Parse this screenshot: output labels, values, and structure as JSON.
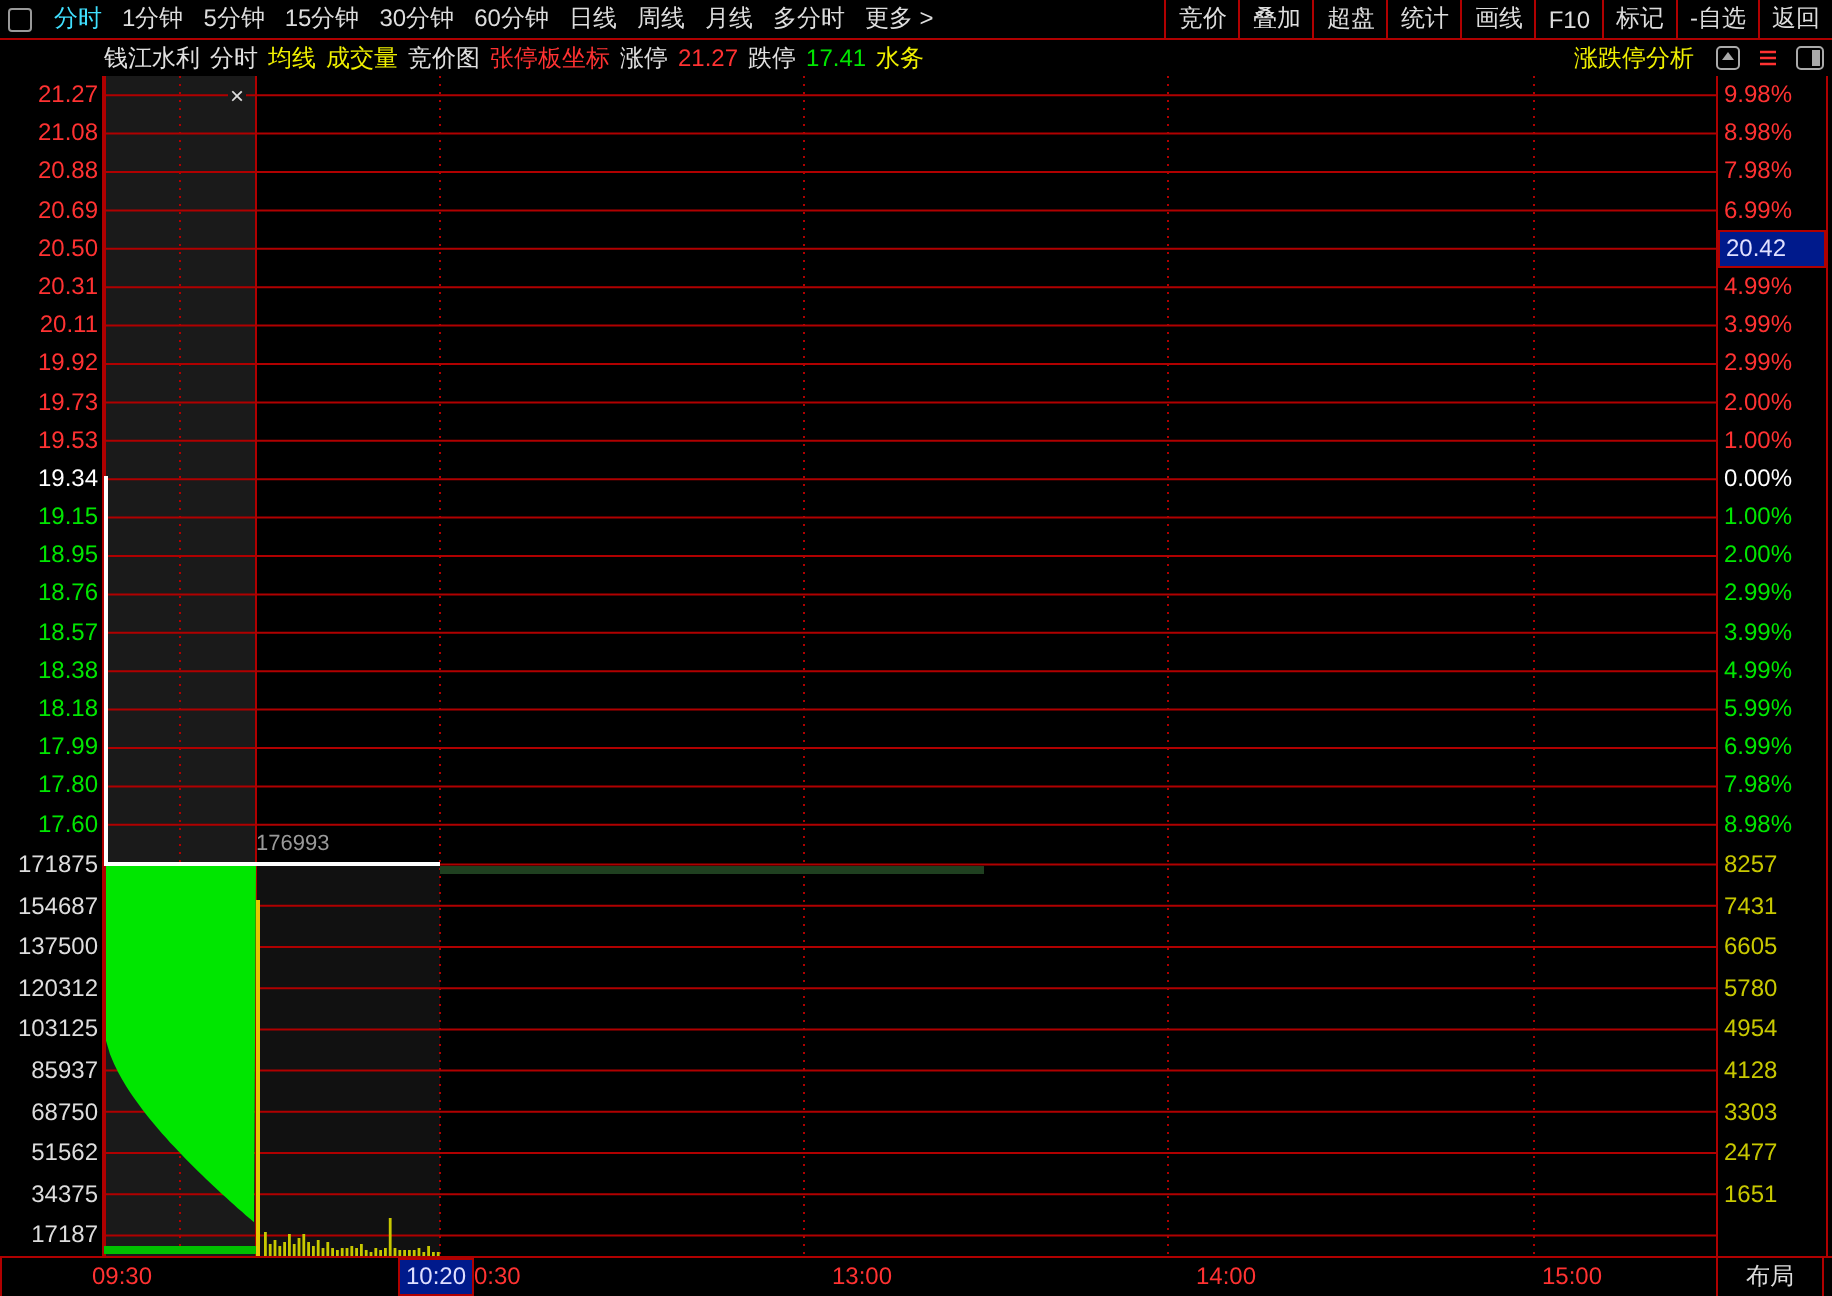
{
  "top_menu": {
    "periods": [
      {
        "label": "分时",
        "selected": true
      },
      {
        "label": "1分钟",
        "selected": false
      },
      {
        "label": "5分钟",
        "selected": false
      },
      {
        "label": "15分钟",
        "selected": false
      },
      {
        "label": "30分钟",
        "selected": false
      },
      {
        "label": "60分钟",
        "selected": false
      },
      {
        "label": "日线",
        "selected": false
      },
      {
        "label": "周线",
        "selected": false
      },
      {
        "label": "月线",
        "selected": false
      },
      {
        "label": "多分时",
        "selected": false
      },
      {
        "label": "更多 >",
        "selected": false
      }
    ],
    "tools": [
      "竞价",
      "叠加",
      "超盘",
      "统计",
      "画线",
      "F10",
      "标记",
      "-自选",
      "返回"
    ]
  },
  "info_bar": {
    "items": [
      {
        "text": "钱江水利",
        "color": "#e0e0e0"
      },
      {
        "text": "分时",
        "color": "#e0e0e0"
      },
      {
        "text": "均线",
        "color": "#f0f000"
      },
      {
        "text": "成交量",
        "color": "#f0f000"
      },
      {
        "text": "竞价图",
        "color": "#e0e0e0"
      },
      {
        "text": "张停板坐标",
        "color": "#ff3232"
      },
      {
        "text": "涨停",
        "color": "#e0e0e0"
      },
      {
        "text": "21.27",
        "color": "#ff3232"
      },
      {
        "text": "跌停",
        "color": "#e0e0e0"
      },
      {
        "text": "17.41",
        "color": "#00e600"
      },
      {
        "text": "水务",
        "color": "#f0f000"
      }
    ],
    "analysis": "涨跌停分析"
  },
  "left_axis": {
    "price": [
      {
        "text": "21.27",
        "kind": "up"
      },
      {
        "text": "21.08",
        "kind": "up"
      },
      {
        "text": "20.88",
        "kind": "up"
      },
      {
        "text": "20.69",
        "kind": "up"
      },
      {
        "text": "20.50",
        "kind": "up"
      },
      {
        "text": "20.31",
        "kind": "up"
      },
      {
        "text": "20.11",
        "kind": "up"
      },
      {
        "text": "19.92",
        "kind": "up"
      },
      {
        "text": "19.73",
        "kind": "up"
      },
      {
        "text": "19.53",
        "kind": "up"
      },
      {
        "text": "19.34",
        "kind": "flat"
      },
      {
        "text": "19.15",
        "kind": "down"
      },
      {
        "text": "18.95",
        "kind": "down"
      },
      {
        "text": "18.76",
        "kind": "down"
      },
      {
        "text": "18.57",
        "kind": "down"
      },
      {
        "text": "18.38",
        "kind": "down"
      },
      {
        "text": "18.18",
        "kind": "down"
      },
      {
        "text": "17.99",
        "kind": "down"
      },
      {
        "text": "17.80",
        "kind": "down"
      },
      {
        "text": "17.60",
        "kind": "down"
      }
    ],
    "volume": [
      "171875",
      "154687",
      "137500",
      "120312",
      "103125",
      "85937",
      "68750",
      "51562",
      "34375",
      "17187"
    ]
  },
  "right_axis": {
    "price": [
      {
        "text": "9.98%",
        "kind": "up"
      },
      {
        "text": "8.98%",
        "kind": "up"
      },
      {
        "text": "7.98%",
        "kind": "up"
      },
      {
        "text": "6.99%",
        "kind": "up"
      },
      {
        "text": "20.42",
        "kind": "cursor"
      },
      {
        "text": "4.99%",
        "kind": "up"
      },
      {
        "text": "3.99%",
        "kind": "up"
      },
      {
        "text": "2.99%",
        "kind": "up"
      },
      {
        "text": "2.00%",
        "kind": "up"
      },
      {
        "text": "1.00%",
        "kind": "up"
      },
      {
        "text": "0.00%",
        "kind": "flat"
      },
      {
        "text": "1.00%",
        "kind": "down"
      },
      {
        "text": "2.00%",
        "kind": "down"
      },
      {
        "text": "2.99%",
        "kind": "down"
      },
      {
        "text": "3.99%",
        "kind": "down"
      },
      {
        "text": "4.99%",
        "kind": "down"
      },
      {
        "text": "5.99%",
        "kind": "down"
      },
      {
        "text": "6.99%",
        "kind": "down"
      },
      {
        "text": "7.98%",
        "kind": "down"
      },
      {
        "text": "8.98%",
        "kind": "down"
      }
    ],
    "volume": [
      "8257",
      "7431",
      "6605",
      "5780",
      "4954",
      "4128",
      "3303",
      "2477",
      "1651"
    ]
  },
  "chart": {
    "volume_callout": "176993",
    "close_mark": "×"
  },
  "time_axis": [
    {
      "text": "09:30",
      "kind": "time"
    },
    {
      "text": "10:20",
      "kind": "cursor"
    },
    {
      "text": "0:30",
      "kind": "time"
    },
    {
      "text": "13:00",
      "kind": "time"
    },
    {
      "text": "14:00",
      "kind": "time"
    },
    {
      "text": "15:00",
      "kind": "time"
    }
  ],
  "layout_button": "布局"
}
